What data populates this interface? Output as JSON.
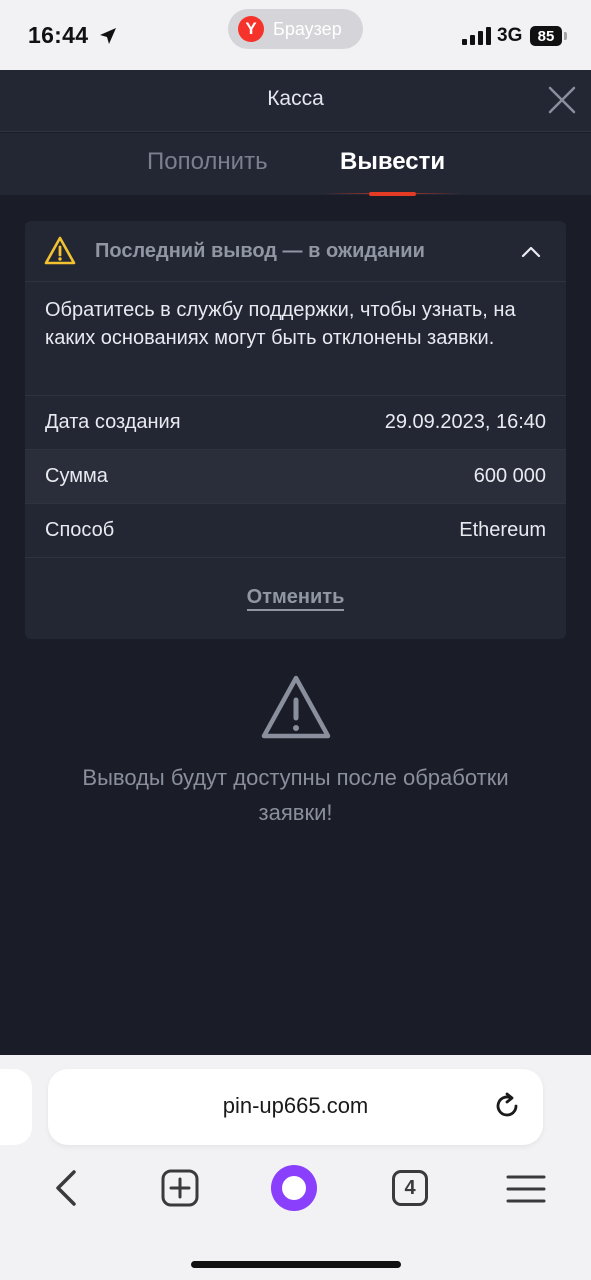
{
  "status_bar": {
    "time": "16:44",
    "browser_pill_logo": "Y",
    "browser_pill_label": "Браузер",
    "network": "3G",
    "battery": "85"
  },
  "header": {
    "title": "Касса"
  },
  "tabs": [
    {
      "label": "Пополнить",
      "active": false
    },
    {
      "label": "Вывести",
      "active": true
    }
  ],
  "withdrawal_card": {
    "title": "Последний вывод — в ожидании",
    "message": "Обратитесь в службу поддержки, чтобы узнать, на каких основаниях могут быть отклонены заявки.",
    "rows": [
      {
        "label": "Дата создания",
        "value": "29.09.2023, 16:40"
      },
      {
        "label": "Сумма",
        "value": "600 000"
      },
      {
        "label": "Способ",
        "value": "Ethereum"
      }
    ],
    "cancel_label": "Отменить"
  },
  "info": {
    "text": "Выводы будут доступны после обработки заявки!"
  },
  "browser": {
    "url": "pin-up665.com",
    "tab_count": "4"
  },
  "colors": {
    "background": "#1a1d27",
    "panel": "#232734",
    "accent": "#e43c24",
    "warning": "#f2c230",
    "alice": "#8a3ffc"
  },
  "icons": [
    "location-arrow-icon",
    "signal-icon",
    "close-icon",
    "warning-icon",
    "chevron-up-icon",
    "alert-triangle-icon",
    "reload-icon",
    "back-arrow-icon",
    "new-tab-icon",
    "alice-icon",
    "tabs-icon",
    "menu-icon"
  ]
}
